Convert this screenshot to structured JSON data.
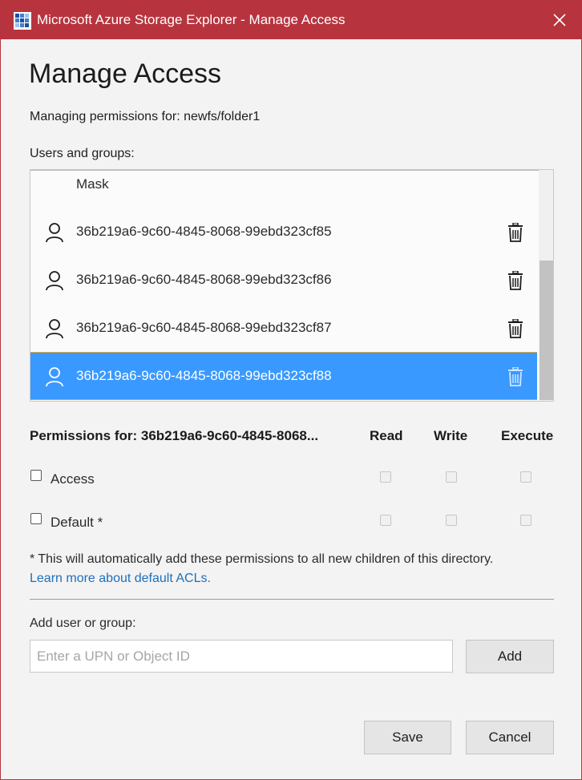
{
  "window": {
    "title": "Microsoft Azure Storage Explorer - Manage Access",
    "accent_color": "#b7343e",
    "app_icon": "azure-storage-explorer-icon",
    "close_icon": "close-icon"
  },
  "page": {
    "heading": "Manage Access",
    "managing_text": "Managing permissions for: newfs/folder1",
    "users_groups_label": "Users and groups:"
  },
  "users_list": {
    "mask_label": "Mask",
    "items": [
      {
        "label": "36b219a6-9c60-4845-8068-99ebd323cf85",
        "icon": "user-icon",
        "selected": false
      },
      {
        "label": "36b219a6-9c60-4845-8068-99ebd323cf86",
        "icon": "user-icon",
        "selected": false
      },
      {
        "label": "36b219a6-9c60-4845-8068-99ebd323cf87",
        "icon": "user-icon",
        "selected": false
      },
      {
        "label": "36b219a6-9c60-4845-8068-99ebd323cf88",
        "icon": "user-icon",
        "selected": true
      }
    ],
    "selection_color": "#3a99ff"
  },
  "permissions": {
    "header": "Permissions for: 36b219a6-9c60-4845-8068...",
    "columns": [
      "Read",
      "Write",
      "Execute"
    ],
    "rows": [
      {
        "label": "Access",
        "checked": false,
        "read": false,
        "write": false,
        "execute": false
      },
      {
        "label": "Default *",
        "checked": false,
        "read": false,
        "write": false,
        "execute": false
      }
    ]
  },
  "note": {
    "text": "* This will automatically add these permissions to all new children of this directory.",
    "link_text": "Learn more about default ACLs."
  },
  "add_section": {
    "label": "Add user or group:",
    "input_placeholder": "Enter a UPN or Object ID",
    "input_value": "",
    "add_button": "Add"
  },
  "footer": {
    "save_button": "Save",
    "cancel_button": "Cancel"
  }
}
